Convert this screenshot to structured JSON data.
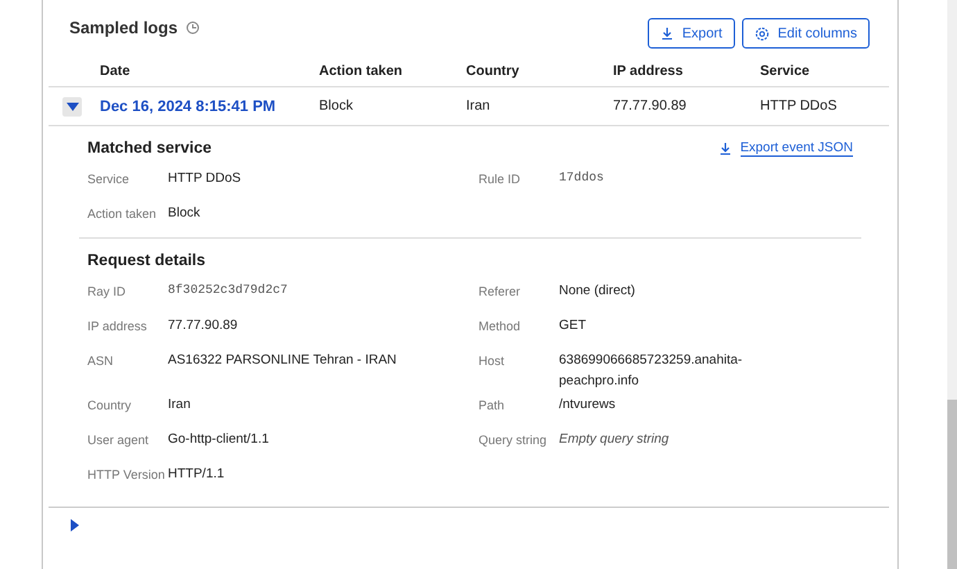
{
  "section": {
    "title": "Sampled logs",
    "buttons": [
      {
        "label": "Export",
        "kind": "download"
      },
      {
        "label": "Edit columns",
        "kind": "settings"
      }
    ]
  },
  "table": {
    "columns": [
      "Date",
      "Action taken",
      "Country",
      "IP address",
      "Service"
    ],
    "rows": [
      {
        "expanded": true,
        "cells": [
          "Dec 16, 2024 8:15:41 PM",
          "Block",
          "Iran",
          "77.77.90.89",
          "HTTP DDoS"
        ]
      }
    ]
  },
  "details": [
    {
      "title": "Matched service",
      "export_link": "Export event JSON",
      "rows": [
        [
          {
            "label": "Service",
            "value": "HTTP DDoS",
            "kind": "plain"
          },
          {
            "label": "Rule ID",
            "value": "17ddos",
            "kind": "mono"
          }
        ],
        [
          {
            "label": "Action taken",
            "value": "Block",
            "kind": "plain"
          }
        ]
      ]
    },
    {
      "title": "Request details",
      "rows": [
        [
          {
            "label": "Ray ID",
            "value": "8f30252c3d79d2c7",
            "kind": "mono"
          },
          {
            "label": "Referer",
            "value": "None (direct)",
            "kind": "plain"
          }
        ],
        [
          {
            "label": "IP address",
            "value": "77.77.90.89",
            "kind": "plain"
          },
          {
            "label": "Method",
            "value": "GET",
            "kind": "plain"
          }
        ],
        [
          {
            "label": "ASN",
            "value": "AS16322 PARSONLINE Tehran - IRAN",
            "kind": "plain"
          },
          {
            "label": "Host",
            "value": "638699066685723259.anahita-peachpro.info",
            "kind": "plain"
          }
        ],
        [
          {
            "label": "Country",
            "value": "Iran",
            "kind": "plain"
          },
          {
            "label": "Path",
            "value": "/ntvurews",
            "kind": "plain"
          }
        ],
        [
          {
            "label": "User agent",
            "value": "Go-http-client/1.1",
            "kind": "plain"
          },
          {
            "label": "Query string",
            "value": "Empty query string",
            "kind": "italic"
          }
        ],
        [
          {
            "label": "HTTP Version",
            "value": "HTTP/1.1",
            "kind": "plain"
          }
        ]
      ]
    }
  ]
}
